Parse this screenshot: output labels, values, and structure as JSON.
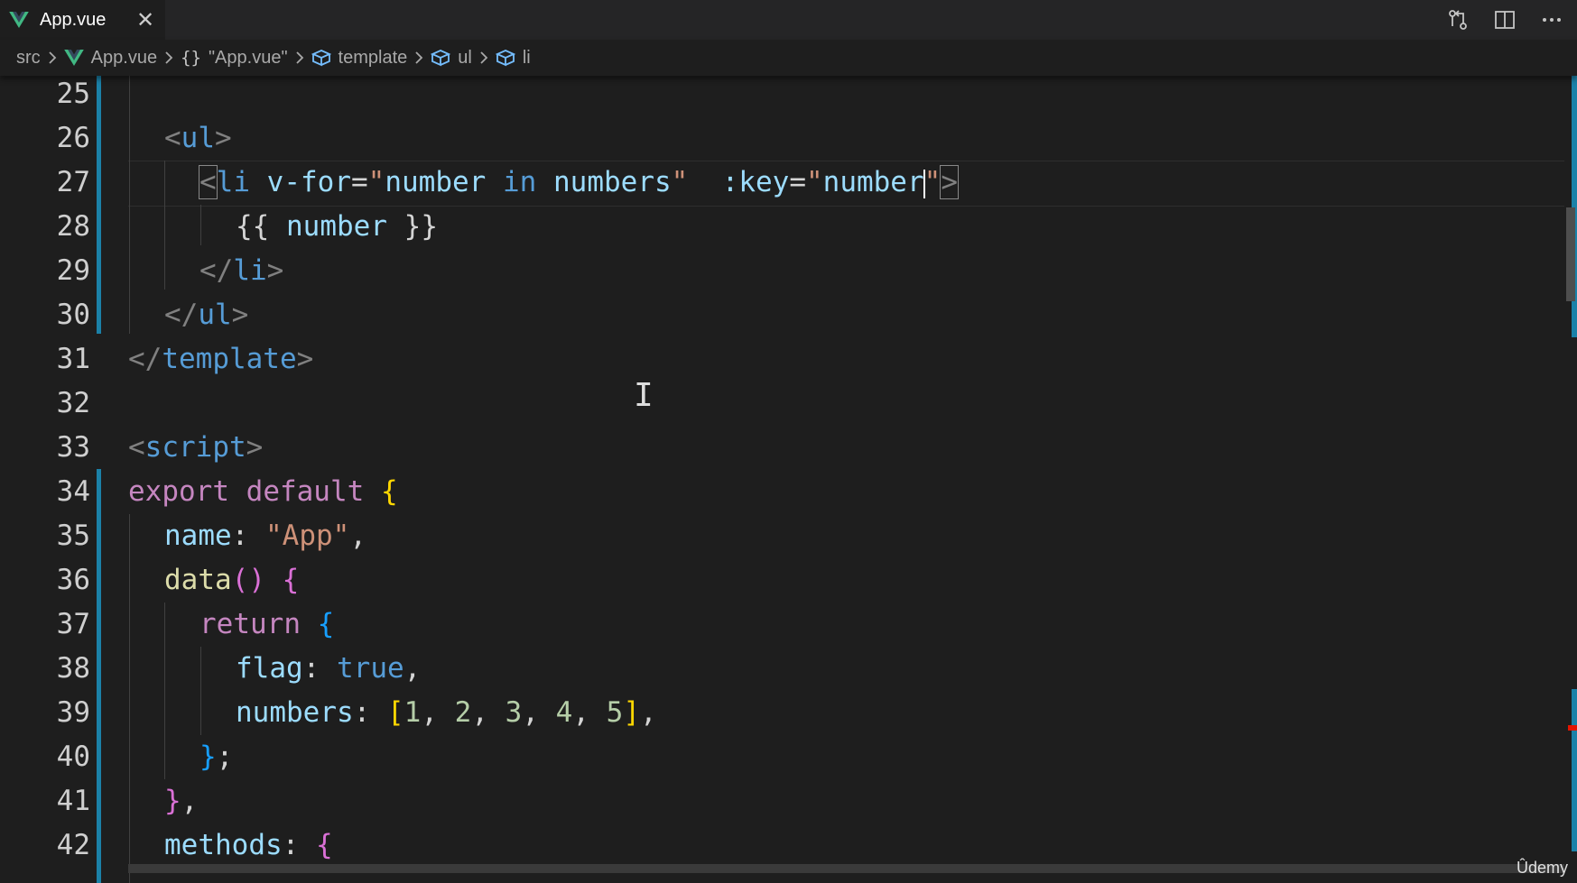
{
  "tab": {
    "title": "App.vue",
    "close_label": "✕",
    "icon": "vue-icon"
  },
  "tab_actions": [
    {
      "name": "compare-changes-icon"
    },
    {
      "name": "split-editor-icon"
    },
    {
      "name": "more-actions-icon"
    }
  ],
  "breadcrumb": {
    "items": [
      {
        "label": "src",
        "icon": ""
      },
      {
        "label": "App.vue",
        "icon": "vue-icon"
      },
      {
        "label": "\"App.vue\"",
        "icon": "braces-icon"
      },
      {
        "label": "template",
        "icon": "symbol-cube-icon"
      },
      {
        "label": "ul",
        "icon": "symbol-cube-icon"
      },
      {
        "label": "li",
        "icon": "symbol-cube-icon"
      }
    ]
  },
  "editor": {
    "line_numbers": [
      "25",
      "26",
      "27",
      "28",
      "29",
      "30",
      "31",
      "32",
      "33",
      "34",
      "35",
      "36",
      "37",
      "38",
      "39",
      "40",
      "41",
      "42"
    ],
    "current_line": "27",
    "code": {
      "l26": {
        "open": "<",
        "tag": "ul",
        "close": ">"
      },
      "l27": {
        "open": "<",
        "tag": "li",
        "attr1": "v-for",
        "eq1": "=",
        "q1": "\"",
        "v1a": "number",
        "v1b": "in",
        "v1c": "numbers",
        "q2": "\"",
        "attr2": ":key",
        "eq2": "=",
        "q3": "\"",
        "v2": "number",
        "q4": "\"",
        "close": ">"
      },
      "l28": {
        "lb": "{{",
        "expr": "number",
        "rb": "}}"
      },
      "l29": {
        "open": "</",
        "tag": "li",
        "close": ">"
      },
      "l30": {
        "open": "</",
        "tag": "ul",
        "close": ">"
      },
      "l31": {
        "open": "</",
        "tag": "template",
        "close": ">"
      },
      "l33": {
        "open": "<",
        "tag": "script",
        "close": ">"
      },
      "l34": {
        "kw1": "export",
        "kw2": "default",
        "brace": "{"
      },
      "l35": {
        "prop": "name",
        "colon": ":",
        "str": "\"App\"",
        "comma": ","
      },
      "l36": {
        "fn": "data",
        "parens": "()",
        "brace": "{"
      },
      "l37": {
        "kw": "return",
        "brace": "{"
      },
      "l38": {
        "prop": "flag",
        "colon": ":",
        "val": "true",
        "comma": ","
      },
      "l39": {
        "prop": "numbers",
        "colon": ":",
        "lb": "[",
        "n1": "1",
        "n2": "2",
        "n3": "3",
        "n4": "4",
        "n5": "5",
        "rb": "]",
        "comma": ","
      },
      "l40": {
        "brace": "}",
        "semi": ";"
      },
      "l41": {
        "brace": "}",
        "comma": ","
      },
      "l42": {
        "prop": "methods",
        "colon": ":",
        "brace": "{"
      }
    }
  },
  "watermark": "Ûdemy",
  "colors": {
    "background": "#1e1e1e",
    "tag": "#569cd6",
    "attribute": "#9cdcfe",
    "string": "#ce9178",
    "keyword": "#c586c0",
    "function": "#dcdcaa",
    "number": "#b5cea8",
    "git_modified": "#1b81a8"
  }
}
